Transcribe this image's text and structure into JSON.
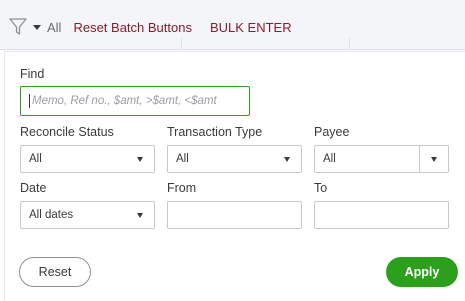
{
  "toolbar": {
    "filter_icon": "filter-funnel-icon",
    "all_label": "All",
    "reset_batch_label": "Reset Batch Buttons",
    "bulk_enter_label": "BULK ENTER"
  },
  "filter_panel": {
    "find_label": "Find",
    "find_placeholder": "Memo, Ref no., $amt, >$amt, <$amt",
    "reconcile_status_label": "Reconcile Status",
    "reconcile_status_value": "All",
    "transaction_type_label": "Transaction Type",
    "transaction_type_value": "All",
    "payee_label": "Payee",
    "payee_value": "All",
    "date_label": "Date",
    "date_value": "All dates",
    "from_label": "From",
    "from_value": "",
    "to_label": "To",
    "to_value": "",
    "reset_label": "Reset",
    "apply_label": "Apply"
  },
  "colors": {
    "accent_green": "#2ca01c",
    "link_red": "#8a1b2c"
  }
}
